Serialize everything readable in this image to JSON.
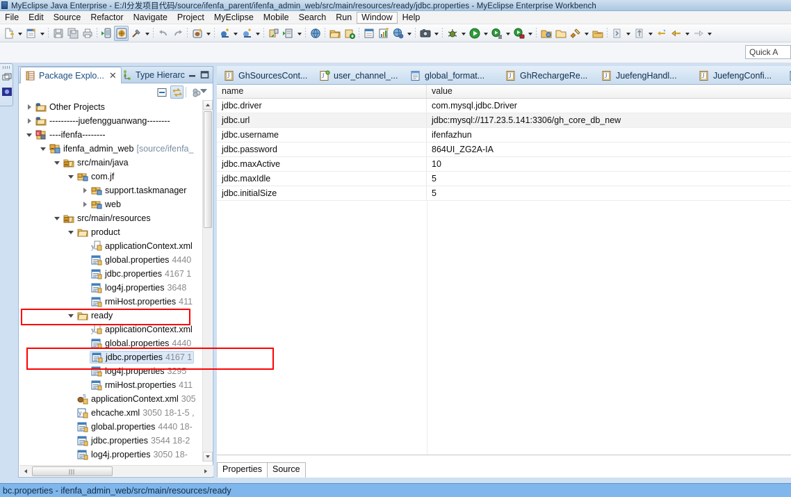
{
  "window": {
    "title": "MyEclipse Java Enterprise - E:/I分发项目代码/source/ifenfa_parent/ifenfa_admin_web/src/main/resources/ready/jdbc.properties - MyEclipse Enterprise Workbench",
    "icon": "myeclipse-icon"
  },
  "menubar": {
    "items": [
      {
        "label": "File"
      },
      {
        "label": "Edit"
      },
      {
        "label": "Source"
      },
      {
        "label": "Refactor"
      },
      {
        "label": "Navigate"
      },
      {
        "label": "Project"
      },
      {
        "label": "MyEclipse"
      },
      {
        "label": "Mobile"
      },
      {
        "label": "Search"
      },
      {
        "label": "Run"
      },
      {
        "label": "Window"
      },
      {
        "label": "Help"
      }
    ],
    "active": "Window"
  },
  "quick_access": {
    "label": "Quick A"
  },
  "package_explorer": {
    "tabs": [
      {
        "label": "Package Explo...",
        "icon": "package-explorer-icon",
        "active": true,
        "closable": true
      },
      {
        "label": "Type Hierarc",
        "icon": "type-hierarchy-icon",
        "active": false,
        "closable": false
      }
    ],
    "view_buttons": [
      {
        "name": "collapse-all-icon"
      },
      {
        "name": "link-with-editor-icon"
      },
      {
        "name": "view-filter-icon"
      },
      {
        "name": "view-menu-icon"
      }
    ],
    "tree": [
      {
        "indent": 0,
        "twist": "collapsed",
        "icon": "project-folder-icon",
        "label": "Other Projects",
        "meta": "",
        "selected": false
      },
      {
        "indent": 0,
        "twist": "collapsed",
        "icon": "project-folder-icon",
        "label": "----------juefengguanwang--------",
        "meta": "",
        "selected": false
      },
      {
        "indent": 0,
        "twist": "expanded",
        "icon": "project-web-icon",
        "label": "----ifenfa--------",
        "meta": "",
        "selected": false
      },
      {
        "indent": 1,
        "twist": "expanded",
        "icon": "project-module-icon",
        "label": "ifenfa_admin_web",
        "dim": "[source/ifenfa_",
        "meta": "",
        "selected": false
      },
      {
        "indent": 2,
        "twist": "expanded",
        "icon": "source-folder-icon",
        "label": "src/main/java",
        "meta": "",
        "selected": false
      },
      {
        "indent": 3,
        "twist": "expanded",
        "icon": "package-icon",
        "label": "com.jf",
        "meta": "",
        "selected": false
      },
      {
        "indent": 4,
        "twist": "collapsed",
        "icon": "package-icon",
        "label": "support.taskmanager",
        "meta": "",
        "selected": false
      },
      {
        "indent": 4,
        "twist": "collapsed",
        "icon": "package-icon",
        "label": "web",
        "meta": "",
        "selected": false
      },
      {
        "indent": 2,
        "twist": "expanded",
        "icon": "source-folder-icon",
        "label": "src/main/resources",
        "meta": "",
        "selected": false
      },
      {
        "indent": 3,
        "twist": "expanded",
        "icon": "folder-icon",
        "label": "product",
        "meta": "",
        "selected": false
      },
      {
        "indent": 4,
        "twist": "none",
        "icon": "spring-xml-icon",
        "label": "applicationContext.xml",
        "meta": "",
        "selected": false
      },
      {
        "indent": 4,
        "twist": "none",
        "icon": "properties-file-icon",
        "label": "global.properties",
        "meta": "4440",
        "selected": false
      },
      {
        "indent": 4,
        "twist": "none",
        "icon": "properties-file-icon",
        "label": "jdbc.properties",
        "meta": "4167  1",
        "selected": false
      },
      {
        "indent": 4,
        "twist": "none",
        "icon": "properties-file-icon",
        "label": "log4j.properties",
        "meta": "3648",
        "selected": false
      },
      {
        "indent": 4,
        "twist": "none",
        "icon": "properties-file-icon",
        "label": "rmiHost.properties",
        "meta": "411",
        "selected": false
      },
      {
        "indent": 3,
        "twist": "expanded",
        "icon": "folder-icon",
        "label": "ready",
        "meta": "",
        "selected": false
      },
      {
        "indent": 4,
        "twist": "none",
        "icon": "spring-xml-icon",
        "label": "applicationContext.xml",
        "meta": "",
        "selected": false
      },
      {
        "indent": 4,
        "twist": "none",
        "icon": "properties-file-icon",
        "label": "global.properties",
        "meta": "4440",
        "selected": false
      },
      {
        "indent": 4,
        "twist": "none",
        "icon": "properties-file-icon",
        "label": "jdbc.properties",
        "meta": "4167  1",
        "selected": true
      },
      {
        "indent": 4,
        "twist": "none",
        "icon": "properties-file-icon",
        "label": "log4j.properties",
        "meta": "3295",
        "selected": false
      },
      {
        "indent": 4,
        "twist": "none",
        "icon": "properties-file-icon",
        "label": "rmiHost.properties",
        "meta": "411",
        "selected": false
      },
      {
        "indent": 3,
        "twist": "none",
        "icon": "spring-bean-xml-icon",
        "label": "applicationContext.xml",
        "meta": "305",
        "selected": false
      },
      {
        "indent": 3,
        "twist": "none",
        "icon": "xml-file-icon",
        "label": "ehcache.xml",
        "meta": "3050   18-1-5 ,",
        "selected": false
      },
      {
        "indent": 3,
        "twist": "none",
        "icon": "properties-file-icon",
        "label": "global.properties",
        "meta": "4440   18-",
        "selected": false
      },
      {
        "indent": 3,
        "twist": "none",
        "icon": "properties-file-icon",
        "label": "jdbc.properties",
        "meta": "3544   18-2",
        "selected": false
      },
      {
        "indent": 3,
        "twist": "none",
        "icon": "properties-file-icon",
        "label": "log4j.properties",
        "meta": "3050   18-",
        "selected": false
      }
    ]
  },
  "editor": {
    "tabs": [
      {
        "label": "GhSourcesCont...",
        "icon": "java-file-icon"
      },
      {
        "label": "user_channel_...",
        "icon": "java-new-file-icon"
      },
      {
        "label": "global_format...",
        "icon": "properties-editor-icon"
      },
      {
        "label": "GhRechargeRe...",
        "icon": "java-file-icon"
      },
      {
        "label": "JuefengHandl...",
        "icon": "java-file-icon"
      },
      {
        "label": "JuefengConfi...",
        "icon": "java-file-icon"
      },
      {
        "label": "",
        "icon": "properties-editor-icon"
      }
    ],
    "properties_table": {
      "columns": [
        "name",
        "value"
      ],
      "rows": [
        {
          "name": "jdbc.driver",
          "value": "com.mysql.jdbc.Driver",
          "selected": false
        },
        {
          "name": "jdbc.url",
          "value": "jdbc:mysql://117.23.5.141:3306/gh_core_db_new",
          "selected": true
        },
        {
          "name": "jdbc.username",
          "value": "ifenfazhun",
          "selected": false
        },
        {
          "name": "jdbc.password",
          "value": "864UI_ZG2A-IA",
          "selected": false
        },
        {
          "name": "jdbc.maxActive",
          "value": "10",
          "selected": false
        },
        {
          "name": "jdbc.maxIdle",
          "value": "5",
          "selected": false
        },
        {
          "name": "jdbc.initialSize",
          "value": "5",
          "selected": false
        }
      ]
    },
    "bottom_tabs": [
      {
        "label": "Properties",
        "active": true
      },
      {
        "label": "Source",
        "active": false
      }
    ]
  },
  "statusbar": {
    "text": "bc.properties - ifenfa_admin_web/src/main/resources/ready"
  },
  "colors": {
    "accent": "#7fb6ec",
    "annotation": "#ff0000",
    "selection": "#dbe8f7",
    "panel_border": "#9bb7d4"
  }
}
